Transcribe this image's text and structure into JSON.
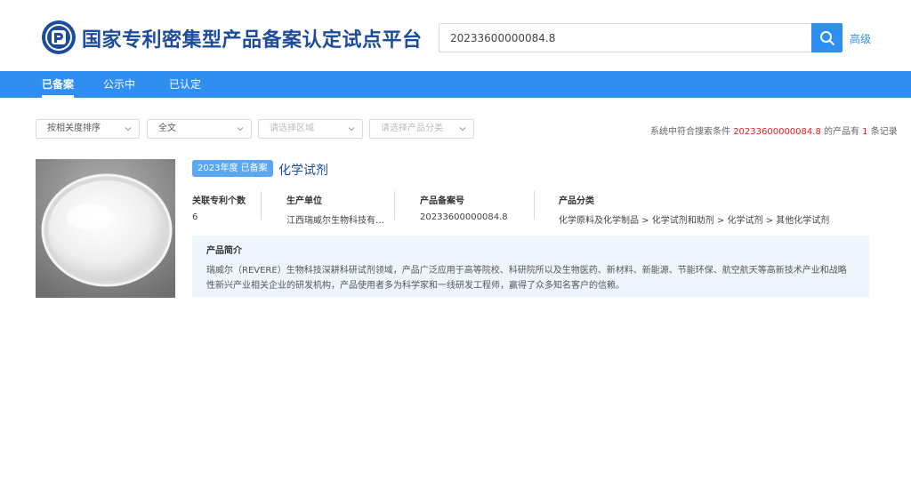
{
  "header": {
    "site_title": "国家专利密集型产品备案认定试点平台",
    "search_value": "20233600000084.8",
    "advanced_label": "高级"
  },
  "nav": {
    "items": [
      {
        "label": "已备案",
        "active": true
      },
      {
        "label": "公示中",
        "active": false
      },
      {
        "label": "已认定",
        "active": false
      }
    ]
  },
  "filters": {
    "sort": "按相关度排序",
    "scope": "全文",
    "region_placeholder": "请选择区域",
    "category_placeholder": "请选择产品分类"
  },
  "summary": {
    "prefix": "系统中符合搜索条件 ",
    "query": "20233600000084.8",
    "middle": " 的产品有 ",
    "count": "1",
    "suffix": " 条记录"
  },
  "result": {
    "badge": "2023年度 已备案",
    "title": "化学试剂",
    "patent_count_label": "关联专利个数",
    "patent_count": "6",
    "manufacturer_label": "生产单位",
    "manufacturer": "江西瑞威尔生物科技有…",
    "record_no_label": "产品备案号",
    "record_no": "20233600000084.8",
    "category_label": "产品分类",
    "category": "化学原料及化学制品 > 化学试剂和助剂 > 化学试剂 > 其他化学试剂",
    "intro_label": "产品简介",
    "intro": "瑞威尔（REVERE）生物科技深耕科研试剂领域，产品广泛应用于高等院校、科研院所以及生物医药、新材料、新能源、节能环保、航空航天等高新技术产业和战略性新兴产业相关企业的研发机构，产品使用者多为科学家和一线研发工程师，赢得了众多知名客户的信赖。"
  },
  "colors": {
    "primary": "#2e8ff0",
    "title_blue": "#1d4c9c",
    "highlight_red": "#e02020",
    "intro_bg": "#eef5fd"
  }
}
